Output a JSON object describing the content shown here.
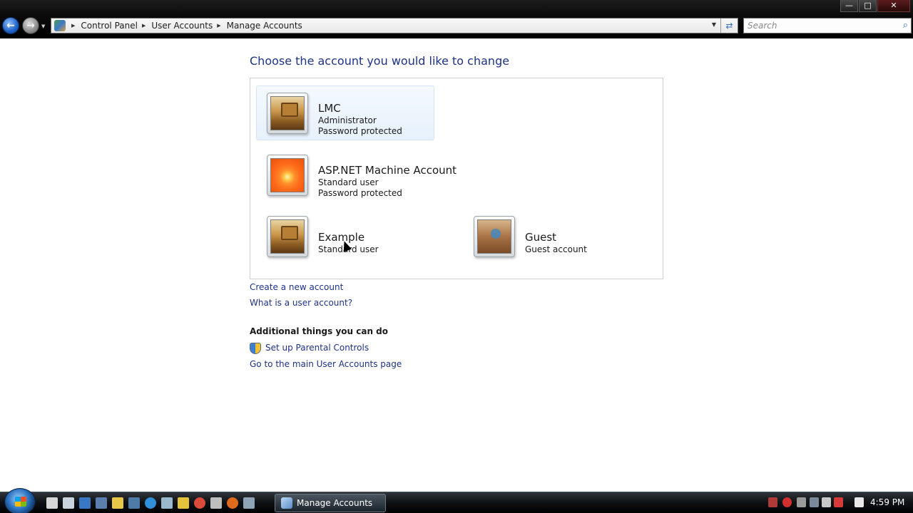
{
  "window": {
    "minimize_label": "—",
    "maximize_label": "□",
    "close_label": "✕"
  },
  "nav": {
    "back_label": "←",
    "forward_label": "→",
    "dropdown_label": "▼"
  },
  "address": {
    "breadcrumbs": [
      "Control Panel",
      "User Accounts",
      "Manage Accounts"
    ],
    "separator": "▶",
    "dropdown_label": "▼",
    "refresh_label": "⇄"
  },
  "search": {
    "placeholder": "Search",
    "button_label": "⌕"
  },
  "page": {
    "heading": "Choose the account you would like to change",
    "accounts": [
      {
        "name": "LMC",
        "role": "Administrator",
        "status": "Password protected",
        "picture": "robot-icon"
      },
      {
        "name": "ASP.NET Machine Account",
        "role": "Standard user",
        "status": "Password protected",
        "picture": "flower-icon"
      },
      {
        "name": "Example",
        "role": "Standard user",
        "status": "",
        "picture": "robot-icon"
      },
      {
        "name": "Guest",
        "role": "Guest account",
        "status": "",
        "picture": "briefcase-icon"
      }
    ],
    "links": {
      "create_account": "Create a new account",
      "what_is_account": "What is a user account?"
    },
    "additional": {
      "heading": "Additional things you can do",
      "parental_controls": "Set up Parental Controls",
      "main_page": "Go to the main User Accounts page"
    }
  },
  "taskbar": {
    "active_window": "Manage Accounts",
    "clock": "4:59 PM"
  },
  "colors": {
    "link": "#1e3287",
    "heading": "#1e3287",
    "selection": "#e6f1fb"
  }
}
